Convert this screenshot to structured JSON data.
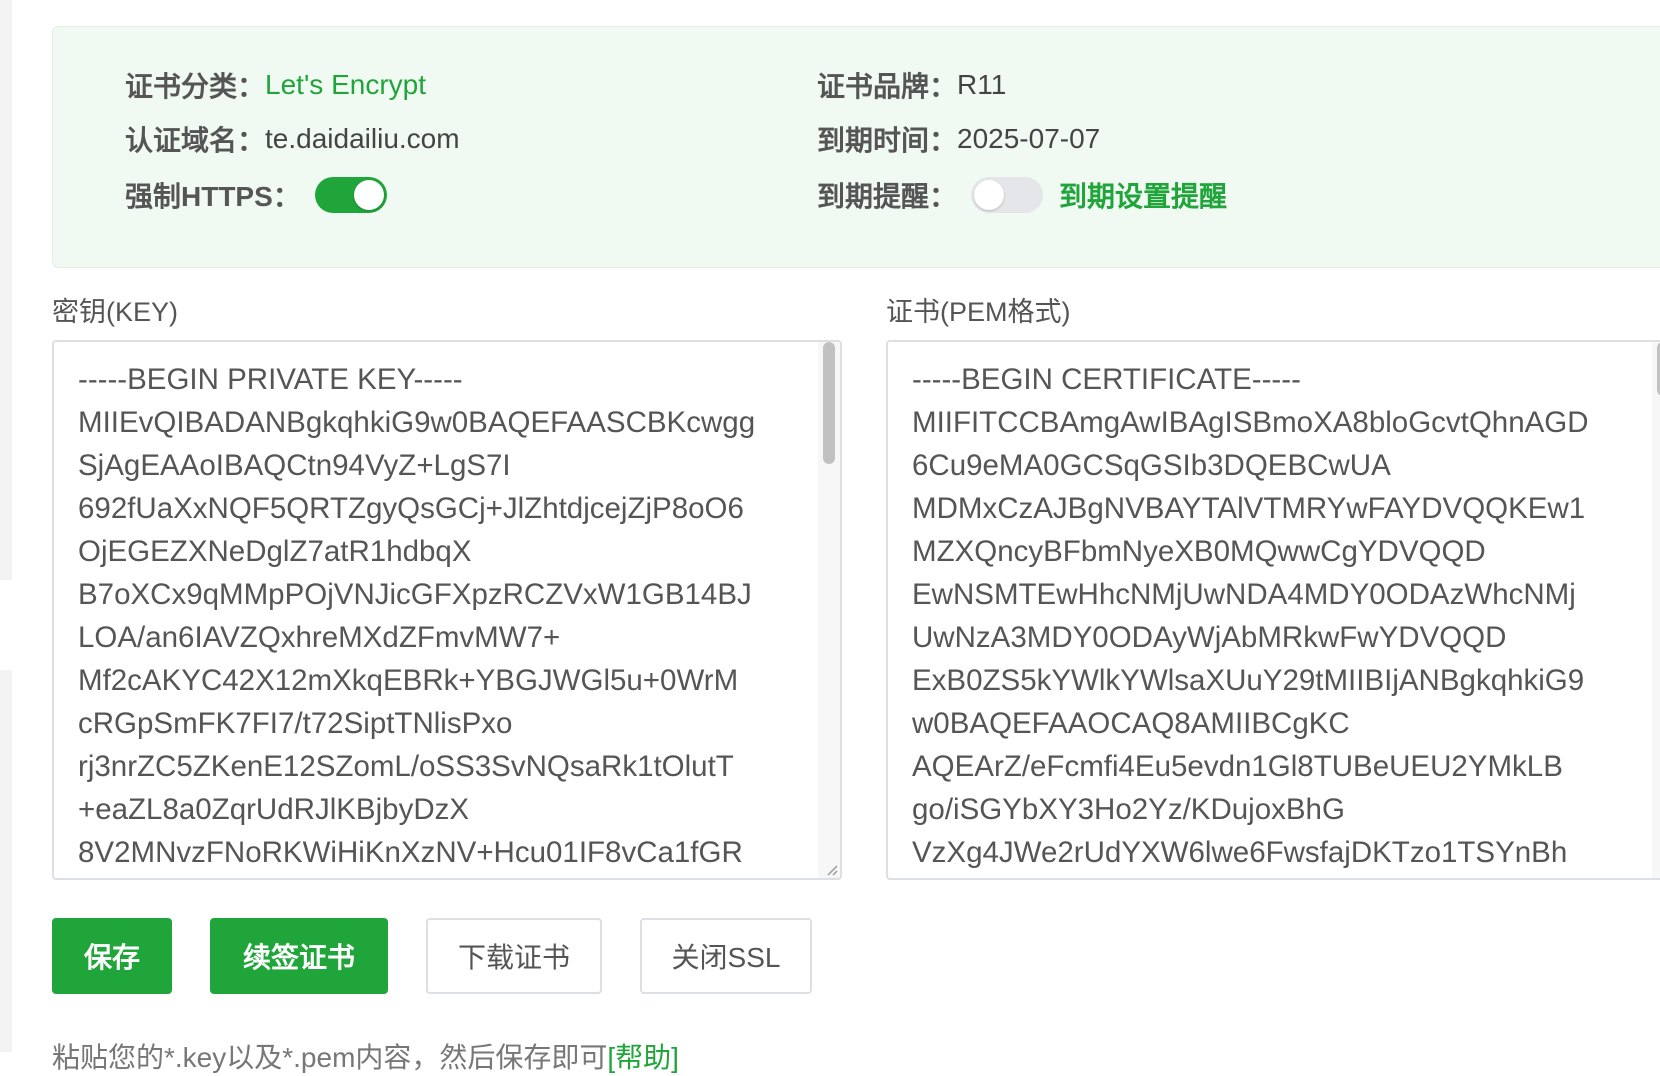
{
  "cert_info": {
    "category_label": "证书分类：",
    "category_value": "Let's Encrypt",
    "brand_label": "证书品牌：",
    "brand_value": "R11",
    "domain_label": "认证域名：",
    "domain_value": "te.daidailiu.com",
    "expire_label": "到期时间：",
    "expire_value": "2025-07-07",
    "force_https_label": "强制HTTPS：",
    "force_https_on": true,
    "reminder_label": "到期提醒：",
    "reminder_on": false,
    "reminder_link": "到期设置提醒"
  },
  "key_field": {
    "label": "密钥(KEY)",
    "content": "-----BEGIN PRIVATE KEY-----\nMIIEvQIBADANBgkqhkiG9w0BAQEFAASCBKcwgg\nSjAgEAAoIBAQCtn94VyZ+LgS7I\n692fUaXxNQF5QRTZgyQsGCj+JlZhtdjcejZjP8oO6\nOjEGEZXNeDglZ7atR1hdbqX\nB7oXCx9qMMpPOjVNJicGFXpzRCZVxW1GB14BJ\nLOA/an6IAVZQxhreMXdZFmvMW7+\nMf2cAKYC42X12mXkqEBRk+YBGJWGl5u+0WrM\ncRGpSmFK7FI7/t72SiptTNlisPxo\nrj3nrZC5ZKenE12SZomL/oSS3SvNQsaRk1tOlutT\n+eaZL8a0ZqrUdRJlKBjbyDzX\n8V2MNvzFNoRKWiHiKnXzNV+Hcu01IF8vCa1fGR"
  },
  "cert_field": {
    "label": "证书(PEM格式)",
    "content": "-----BEGIN CERTIFICATE-----\nMIIFITCCBAmgAwIBAgISBmoXA8bloGcvtQhnAGD\n6Cu9eMA0GCSqGSIb3DQEBCwUA\nMDMxCzAJBgNVBAYTAlVTMRYwFAYDVQQKEw1\nMZXQncyBFbmNyeXB0MQwwCgYDVQQD\nEwNSMTEwHhcNMjUwNDA4MDY0ODAzWhcNMj\nUwNzA3MDY0ODAyWjAbMRkwFwYDVQQD\nExB0ZS5kYWlkYWlsaXUuY29tMIIBIjANBgkqhkiG9\nw0BAQEFAAOCAQ8AMIIBCgKC\nAQEArZ/eFcmfi4Eu5evdn1Gl8TUBeUEU2YMkLB\ngo/iSGYbXY3Ho2Yz/KDujoxBhG\nVzXg4JWe2rUdYXW6lwe6FwsfajDKTzo1TSYnBh"
  },
  "buttons": {
    "save": "保存",
    "renew": "续签证书",
    "download": "下载证书",
    "close_ssl": "关闭SSL"
  },
  "hint": {
    "text": "粘贴您的*.key以及*.pem内容，然后保存即可",
    "help": "[帮助]"
  },
  "colors": {
    "accent": "#20a53a",
    "panel_bg": "#f1f9f3"
  }
}
